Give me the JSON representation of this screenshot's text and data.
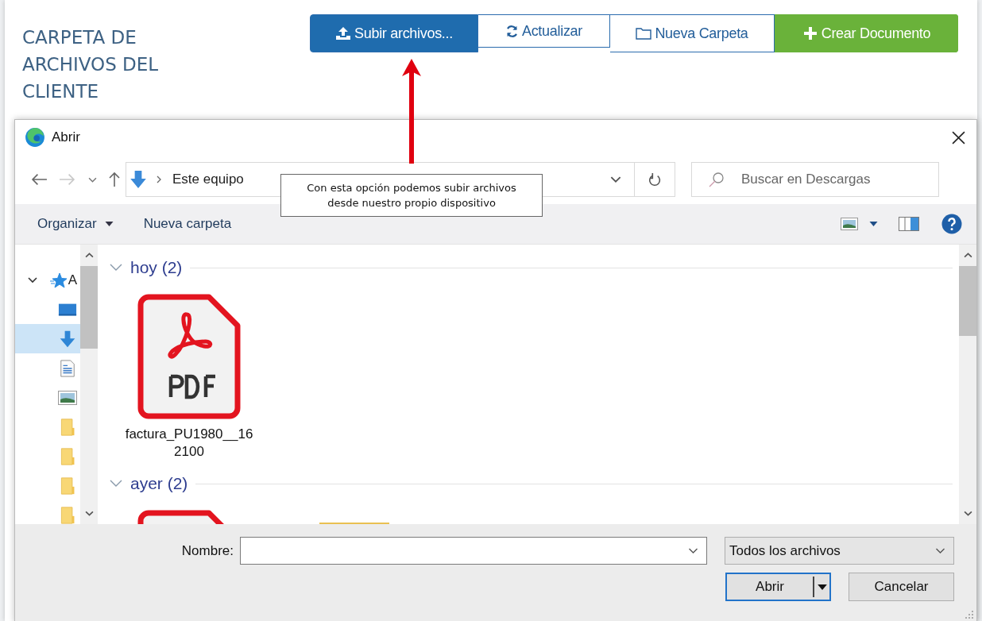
{
  "page": {
    "title": "CARPETA DE ARCHIVOS DEL CLIENTE"
  },
  "actions": [
    {
      "label": "Subir archivos...",
      "kind": "upload"
    },
    {
      "label": "Actualizar",
      "kind": "refresh"
    },
    {
      "label": "Nueva Carpeta",
      "kind": "folder"
    },
    {
      "label": "Crear Documento",
      "kind": "create"
    }
  ],
  "annotation": {
    "text": "Con esta opción podemos subir archivos\ndesde nuestro propio dispositivo"
  },
  "dialog": {
    "title": "Abrir",
    "address": {
      "crumb": "Este equipo"
    },
    "search": {
      "placeholder": "Buscar en Descargas"
    },
    "toolbar": [
      {
        "label": "Organizar",
        "kind": "menu"
      },
      {
        "label": "Nueva carpeta",
        "kind": "plain"
      }
    ],
    "nav_items": [
      {
        "kind": "quick-access",
        "label": "A",
        "expanded": true,
        "selected": false
      },
      {
        "kind": "desktop",
        "selected": false
      },
      {
        "kind": "downloads",
        "selected": true
      },
      {
        "kind": "documents",
        "selected": false
      },
      {
        "kind": "pictures",
        "selected": false
      },
      {
        "kind": "folder",
        "selected": false
      },
      {
        "kind": "folder",
        "selected": false
      },
      {
        "kind": "folder",
        "selected": false
      },
      {
        "kind": "folder",
        "selected": false
      }
    ],
    "groups": [
      {
        "label": "hoy (2)",
        "expanded": true,
        "files": [
          {
            "kind": "pdf",
            "name": "factura_PU1980__16\n2100"
          }
        ]
      },
      {
        "label": "ayer (2)",
        "expanded": true,
        "files": [
          {
            "kind": "pdf"
          },
          {
            "kind": "folder"
          }
        ]
      }
    ],
    "file_name": {
      "label": "Nombre:"
    },
    "filter": {
      "value": "Todos los archivos"
    },
    "buttons": [
      {
        "label": "Abrir",
        "kind": "primary"
      },
      {
        "label": "Cancelar",
        "kind": "plain"
      }
    ]
  }
}
